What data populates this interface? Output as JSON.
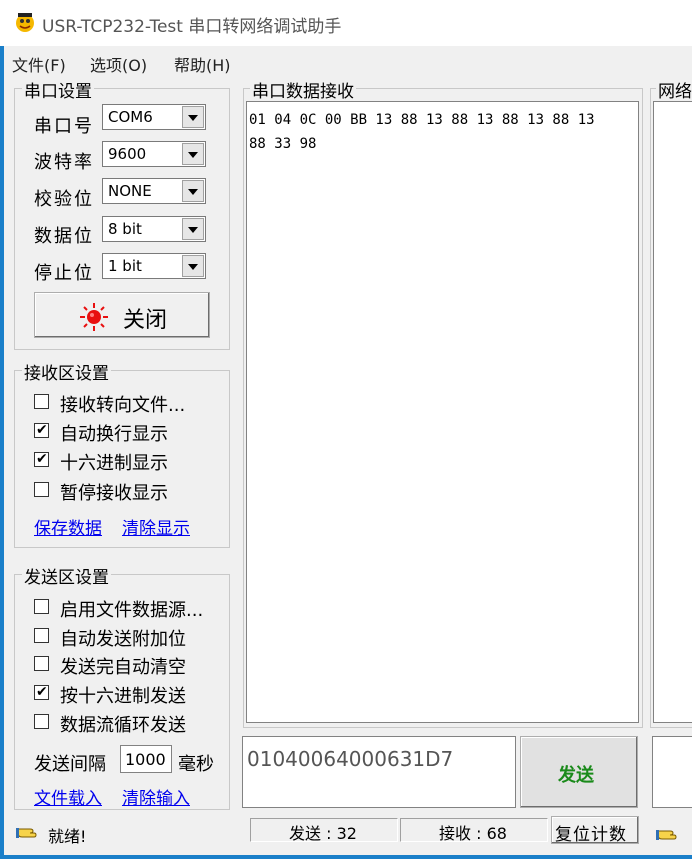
{
  "window": {
    "title": "USR-TCP232-Test 串口转网络调试助手",
    "icon": "app-mascot-icon"
  },
  "menu": [
    "文件(F)",
    "选项(O)",
    "帮助(H)"
  ],
  "serial_settings": {
    "title": "串口设置",
    "port_label": "串口号",
    "port_value": "COM6",
    "baud_label": "波特率",
    "baud_value": "9600",
    "parity_label": "校验位",
    "parity_value": "NONE",
    "databits_label": "数据位",
    "databits_value": "8 bit",
    "stopbits_label": "停止位",
    "stopbits_value": "1 bit",
    "toggle_label": "关闭",
    "toggle_icon": "red-indicator-icon",
    "indicator_color": "#e81010"
  },
  "receive_settings": {
    "title": "接收区设置",
    "options": [
      {
        "label": "接收转向文件...",
        "checked": false
      },
      {
        "label": "自动换行显示",
        "checked": true
      },
      {
        "label": "十六进制显示",
        "checked": true
      },
      {
        "label": "暂停接收显示",
        "checked": false
      }
    ],
    "save_link": "保存数据",
    "clear_link": "清除显示"
  },
  "send_settings": {
    "title": "发送区设置",
    "options": [
      {
        "label": "启用文件数据源...",
        "checked": false
      },
      {
        "label": "自动发送附加位",
        "checked": false
      },
      {
        "label": "发送完自动清空",
        "checked": false
      },
      {
        "label": "按十六进制发送",
        "checked": true
      },
      {
        "label": "数据流循环发送",
        "checked": false
      }
    ],
    "interval_label": "发送间隔",
    "interval_value": "1000",
    "interval_unit": "毫秒",
    "load_link": "文件载入",
    "clear_link": "清除输入"
  },
  "serial_receive": {
    "title": "串口数据接收",
    "line1": "01 04 0C 00 BB 13 88 13 88 13 88 13 88 13",
    "line2": "88 33 98"
  },
  "network_panel": {
    "title_partial": "网络"
  },
  "send_box": {
    "value": "01040064000631D7",
    "send_button": "发送",
    "send_color": "#1a8a1a"
  },
  "status_bar": {
    "ready": "就绪!",
    "sent": "发送 : 32",
    "received": "接收 : 68",
    "reset": "复位计数"
  }
}
